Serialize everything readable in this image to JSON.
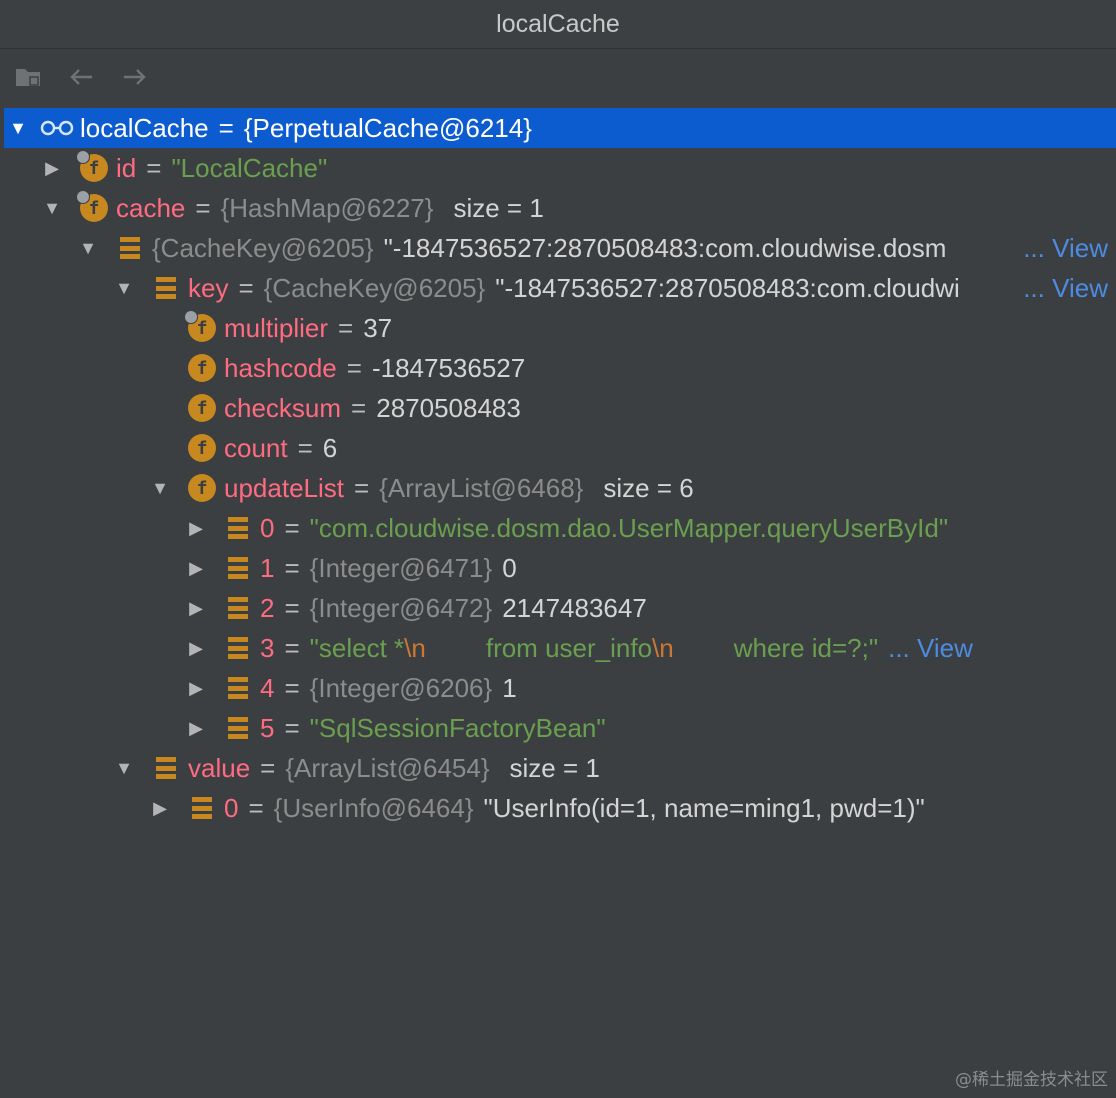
{
  "window": {
    "title": "localCache"
  },
  "tree": {
    "root": {
      "name": "localCache",
      "eq": "=",
      "value": "{PerpetualCache@6214}"
    },
    "id": {
      "name": "id",
      "eq": "=",
      "value": "\"LocalCache\""
    },
    "cache": {
      "name": "cache",
      "eq": "=",
      "ref": "{HashMap@6227}",
      "extra": "size = 1"
    },
    "entry": {
      "ref": "{CacheKey@6205}",
      "value": "\"-1847536527:2870508483:com.cloudwise.dosm",
      "ellipsis": "...",
      "view": "View"
    },
    "key": {
      "name": "key",
      "eq": "=",
      "ref": "{CacheKey@6205}",
      "value": "\"-1847536527:2870508483:com.cloudwi",
      "ellipsis": "...",
      "view": "View"
    },
    "multiplier": {
      "name": "multiplier",
      "eq": "=",
      "value": "37"
    },
    "hashcode": {
      "name": "hashcode",
      "eq": "=",
      "value": "-1847536527"
    },
    "checksum": {
      "name": "checksum",
      "eq": "=",
      "value": "2870508483"
    },
    "count": {
      "name": "count",
      "eq": "=",
      "value": "6"
    },
    "updateList": {
      "name": "updateList",
      "eq": "=",
      "ref": "{ArrayList@6468}",
      "extra": "size = 6"
    },
    "u0": {
      "name": "0",
      "eq": "=",
      "value": "\"com.cloudwise.dosm.dao.UserMapper.queryUserById\""
    },
    "u1": {
      "name": "1",
      "eq": "=",
      "ref": "{Integer@6471}",
      "value": "0"
    },
    "u2": {
      "name": "2",
      "eq": "=",
      "ref": "{Integer@6472}",
      "value": "2147483647"
    },
    "u3": {
      "name": "3",
      "eq": "=",
      "s1": "\"select *",
      "esc1": "\\n",
      "s2": "from user_info",
      "esc2": "\\n",
      "s3": "where id=?;\"",
      "ellipsis": "...",
      "view": "View"
    },
    "u4": {
      "name": "4",
      "eq": "=",
      "ref": "{Integer@6206}",
      "value": "1"
    },
    "u5": {
      "name": "5",
      "eq": "=",
      "value": "\"SqlSessionFactoryBean\""
    },
    "value": {
      "name": "value",
      "eq": "=",
      "ref": "{ArrayList@6454}",
      "extra": "size = 1"
    },
    "v0": {
      "name": "0",
      "eq": "=",
      "ref": "{UserInfo@6464}",
      "value": "\"UserInfo(id=1, name=ming1, pwd=1)\""
    }
  },
  "toolbar": {
    "icons": [
      "folder-icon",
      "back-arrow-icon",
      "forward-arrow-icon"
    ]
  },
  "watermark": "@稀土掘金技术社区",
  "colors": {
    "selection": "#0d5ccf",
    "field_name": "#ff6b81",
    "string": "#6a9f4f",
    "escape": "#cc7832",
    "link": "#4c8be0",
    "icon": "#c78820"
  }
}
